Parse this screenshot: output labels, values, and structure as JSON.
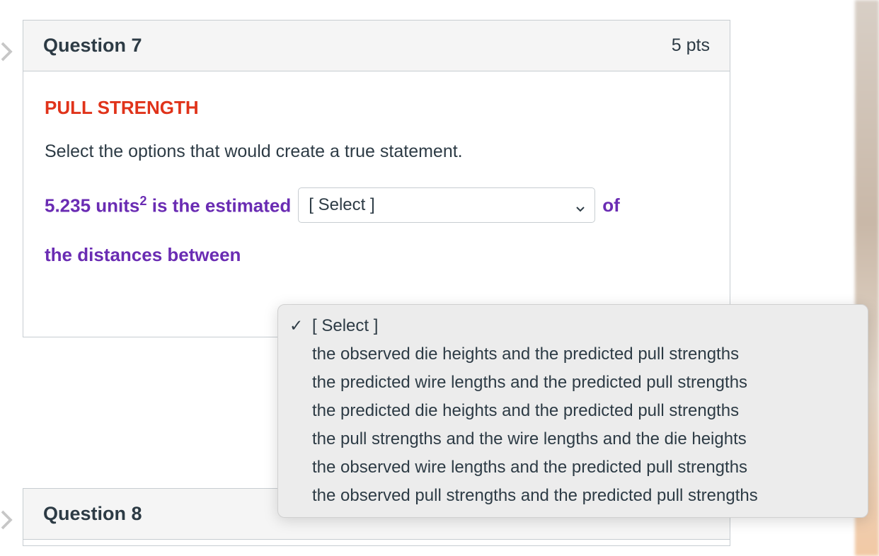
{
  "question7": {
    "title": "Question 7",
    "points": "5 pts",
    "heading": "PULL STRENGTH",
    "instruction": "Select the options that would create a true statement.",
    "statement_part1_prefix": "5.235 units",
    "statement_part1_exp": "2",
    "statement_part1_suffix": " is the estimated",
    "select_placeholder": "[ Select ]",
    "statement_of": "of",
    "statement_part2": "the distances between"
  },
  "dropdown": {
    "options": [
      "[ Select ]",
      "the observed die heights and the predicted pull strengths",
      "the predicted wire lengths and the predicted pull strengths",
      "the predicted die heights and the predicted pull strengths",
      "the pull strengths and the wire lengths and the die heights",
      "the observed wire lengths and the predicted pull strengths",
      "the observed pull strengths and the predicted pull strengths"
    ],
    "selected_index": 0
  },
  "question8": {
    "title": "Question 8"
  }
}
